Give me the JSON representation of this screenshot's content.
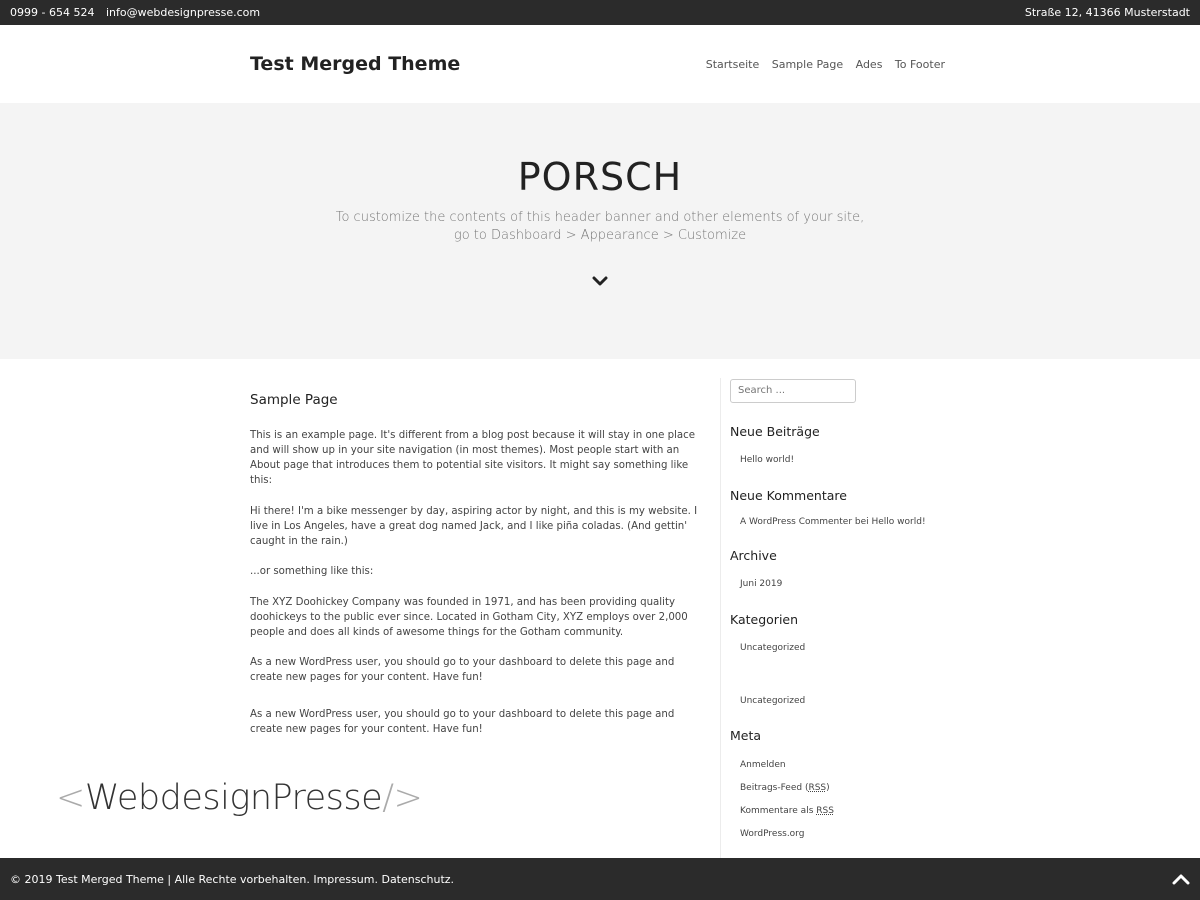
{
  "topbar": {
    "phone": "0999 - 654 524",
    "email": "info@webdesignpresse.com",
    "address": "Straße 12, 41366 Musterstadt"
  },
  "header": {
    "site_title": "Test Merged Theme",
    "nav": [
      "Startseite",
      "Sample Page",
      "Ades",
      "To Footer"
    ]
  },
  "hero": {
    "title": "PORSCH",
    "subtitle_line1": "To customize the contents of this header banner and other elements of your site,",
    "subtitle_line2": "go to Dashboard > Appearance > Customize",
    "icon": "chevron-down-icon"
  },
  "content": {
    "title": "Sample Page",
    "paragraphs": [
      "This is an example page. It's different from a blog post because it will stay in one place and will show up in your site navigation (in most themes). Most people start with an About page that introduces them to potential site visitors. It might say something like this:",
      "Hi there! I'm a bike messenger by day, aspiring actor by night, and this is my website. I live in Los Angeles, have a great dog named Jack, and I like piña coladas. (And gettin' caught in the rain.)",
      "...or something like this:",
      "The XYZ Doohickey Company was founded in 1971, and has been providing quality doohickeys to the public ever since. Located in Gotham City, XYZ employs over 2,000 people and does all kinds of awesome things for the Gotham community.",
      "As a new WordPress user, you should go to your dashboard to delete this page and create new pages for your content. Have fun!"
    ],
    "duplicate_paragraph": "As a new WordPress user, you should go to your dashboard to delete this page and create new pages for your content. Have fun!"
  },
  "sidebar": {
    "search_placeholder": "Search ...",
    "recent_posts_title": "Neue Beiträge",
    "recent_post": "Hello world!",
    "recent_comments_title": "Neue Kommentare",
    "recent_comment": "A WordPress Commenter bei Hello world!",
    "archive_title": "Archive",
    "archive_item": "Juni 2019",
    "categories_title": "Kategorien",
    "category_item": "Uncategorized",
    "overlap_category_item": "Uncategorized",
    "meta_title": "Meta",
    "meta_login": "Anmelden",
    "meta_feed_prefix": "Beitrags-Feed (",
    "meta_rss": "RSS",
    "meta_feed_suffix": ")",
    "meta_comments_prefix": "Kommentare als ",
    "meta_wordpress": "WordPress.org"
  },
  "logo": {
    "open": "<",
    "name": "WebdesignPresse",
    "close": "/>"
  },
  "footer": {
    "text": "© 2019 Test Merged Theme  | Alle Rechte vorbehalten. Impressum. Datenschutz.",
    "icon": "chevron-up-icon"
  }
}
